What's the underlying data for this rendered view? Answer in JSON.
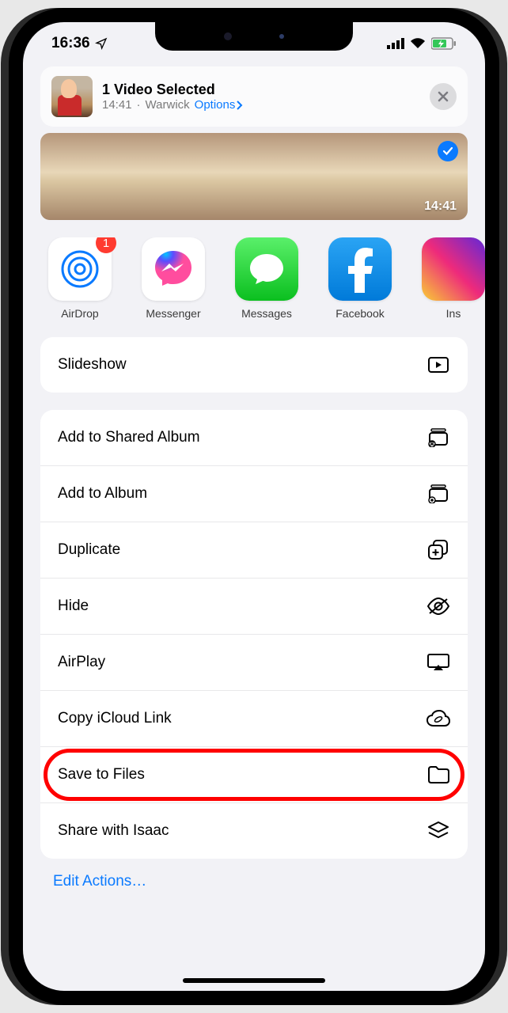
{
  "status": {
    "time": "16:36",
    "location_glyph": "➤"
  },
  "header": {
    "title": "1 Video Selected",
    "time": "14:41",
    "location": "Warwick",
    "options_label": "Options"
  },
  "preview": {
    "timestamp": "14:41"
  },
  "apps": [
    {
      "label": "AirDrop",
      "badge": "1"
    },
    {
      "label": "Messenger"
    },
    {
      "label": "Messages"
    },
    {
      "label": "Facebook"
    },
    {
      "label": "Ins"
    }
  ],
  "actions_group1": [
    {
      "label": "Slideshow",
      "icon": "play"
    }
  ],
  "actions_group2": [
    {
      "label": "Add to Shared Album",
      "icon": "shared-album"
    },
    {
      "label": "Add to Album",
      "icon": "add-album"
    },
    {
      "label": "Duplicate",
      "icon": "duplicate"
    },
    {
      "label": "Hide",
      "icon": "hide"
    },
    {
      "label": "AirPlay",
      "icon": "airplay"
    },
    {
      "label": "Copy iCloud Link",
      "icon": "cloud-link"
    },
    {
      "label": "Save to Files",
      "icon": "folder",
      "highlighted": true
    },
    {
      "label": "Share with Isaac",
      "icon": "layers"
    }
  ],
  "edit_actions": "Edit Actions…"
}
